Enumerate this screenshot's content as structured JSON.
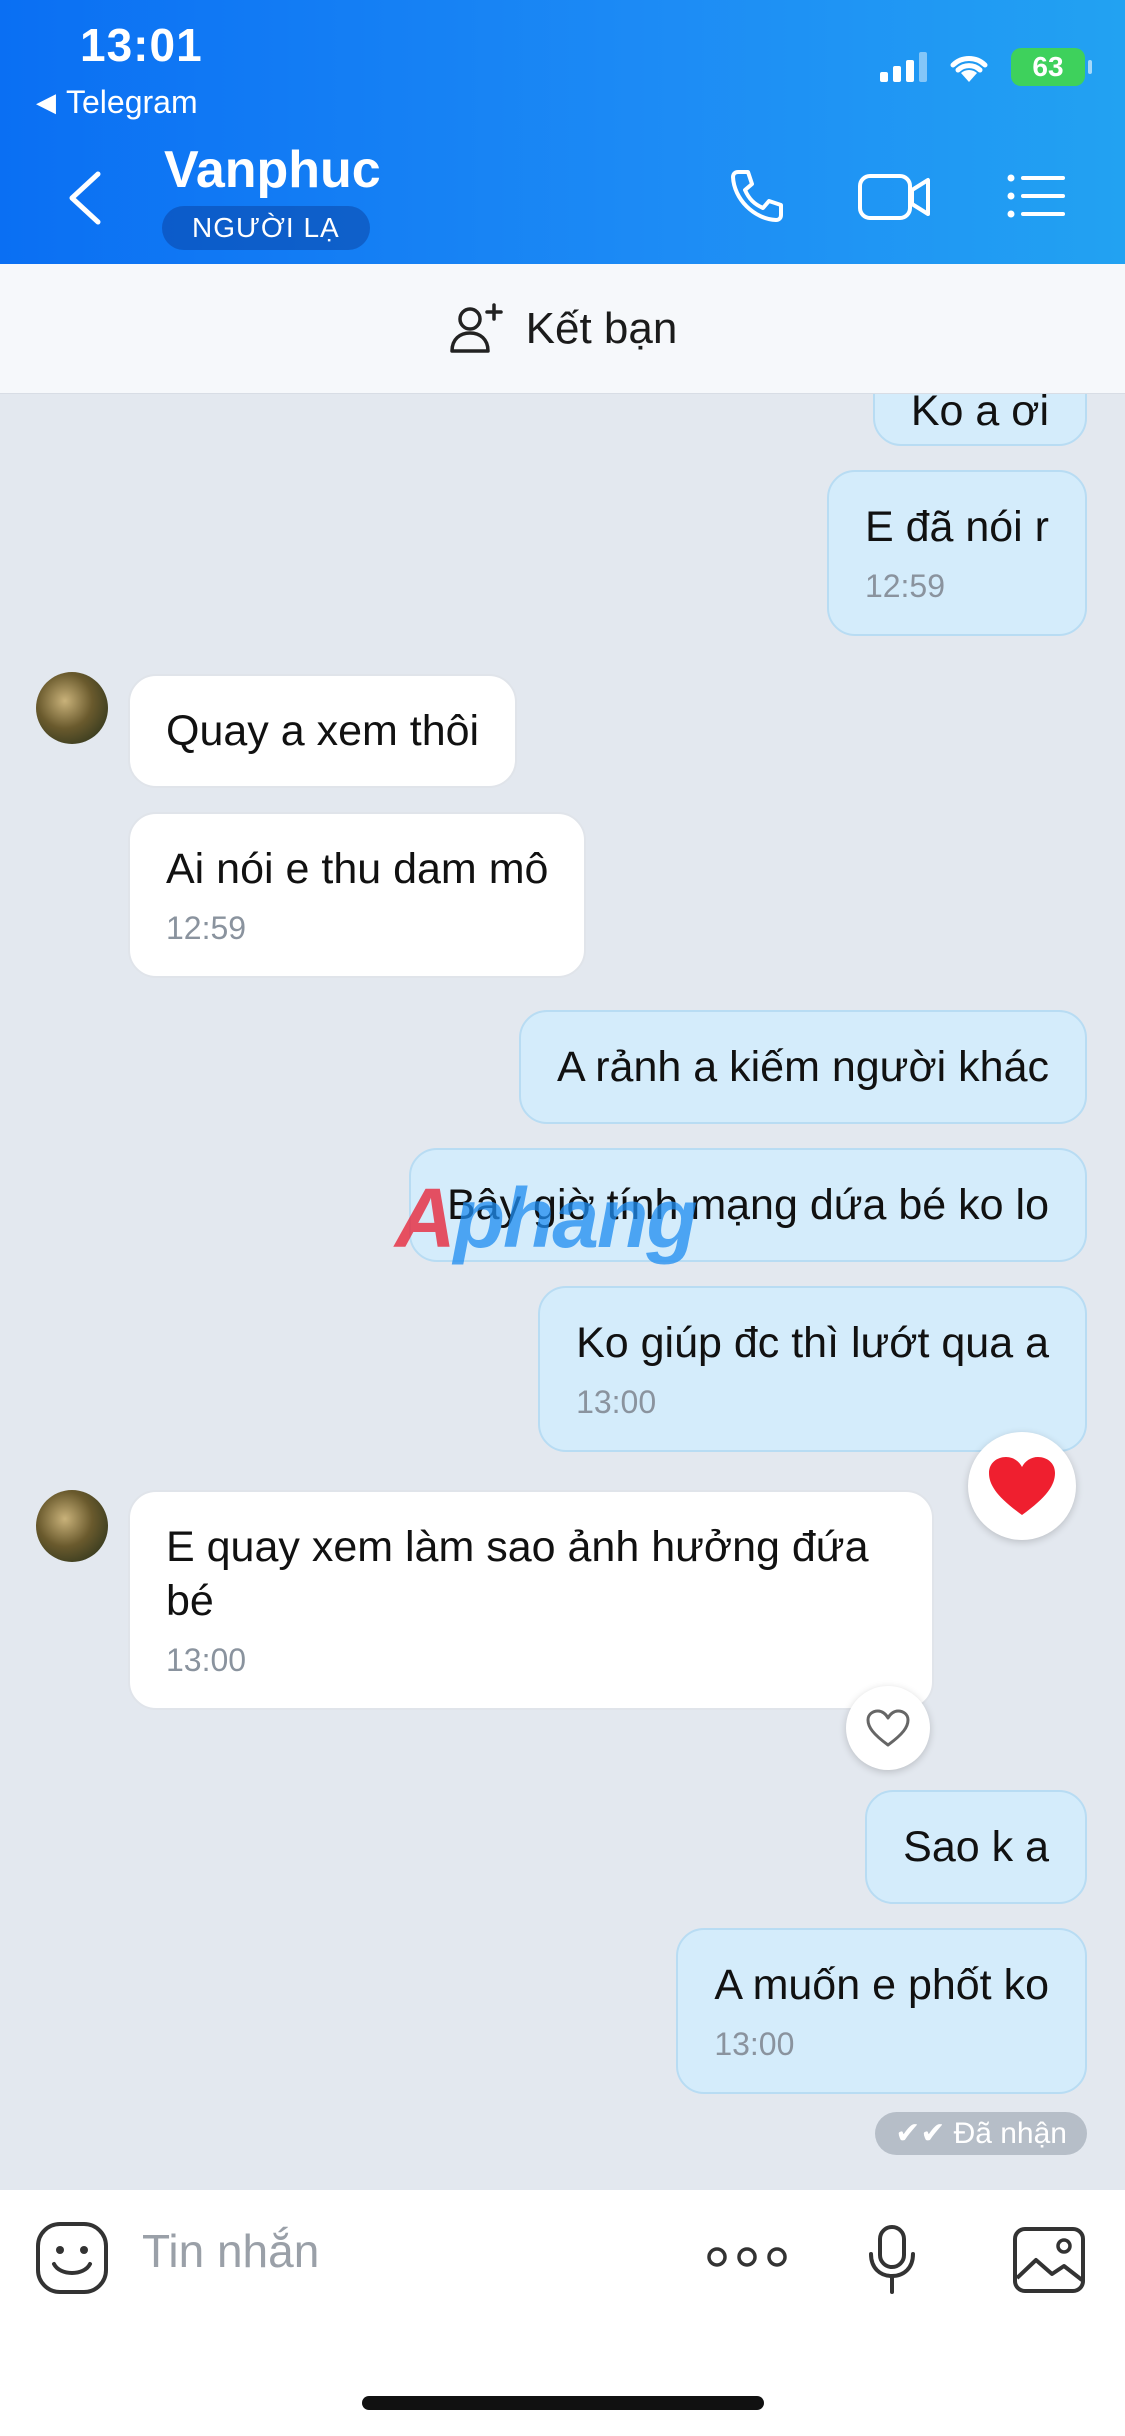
{
  "status_bar": {
    "time": "13:01",
    "back_app": "Telegram",
    "battery": "63"
  },
  "header": {
    "contact_name": "Vanphuc",
    "badge": "NGƯỜI LẠ"
  },
  "add_friend": {
    "label": "Kết bạn"
  },
  "messages": [
    {
      "direction": "out",
      "text": "Ko a ơi",
      "time": ""
    },
    {
      "direction": "out",
      "text": "E đã nói r",
      "time": "12:59"
    },
    {
      "direction": "in",
      "text": "Quay a xem thôi",
      "time": ""
    },
    {
      "direction": "in",
      "text": "Ai nói e thu dam mô",
      "time": "12:59"
    },
    {
      "direction": "out",
      "text": "A rảnh a kiếm người khác",
      "time": ""
    },
    {
      "direction": "out",
      "text": "Bây giờ tính mạng dứa bé ko lo",
      "time": ""
    },
    {
      "direction": "out",
      "text": "Ko giúp đc thì lướt qua a",
      "time": "13:00",
      "reaction": "heart-red"
    },
    {
      "direction": "in",
      "text": "E quay xem làm sao ảnh hưởng đứa bé",
      "time": "13:00",
      "reaction": "heart-outline"
    },
    {
      "direction": "out",
      "text": "Sao k a",
      "time": ""
    },
    {
      "direction": "out",
      "text": "A muốn e phốt ko",
      "time": "13:00"
    }
  ],
  "delivery_status": "Đã nhận",
  "watermark": {
    "first": "A",
    "rest": "phang"
  },
  "input": {
    "placeholder": "Tin nhắn"
  },
  "colors": {
    "header": "#0a6ff3",
    "out_bubble": "#d4ecfb",
    "in_bubble": "#ffffff",
    "chat_bg": "#e3e8ef"
  }
}
